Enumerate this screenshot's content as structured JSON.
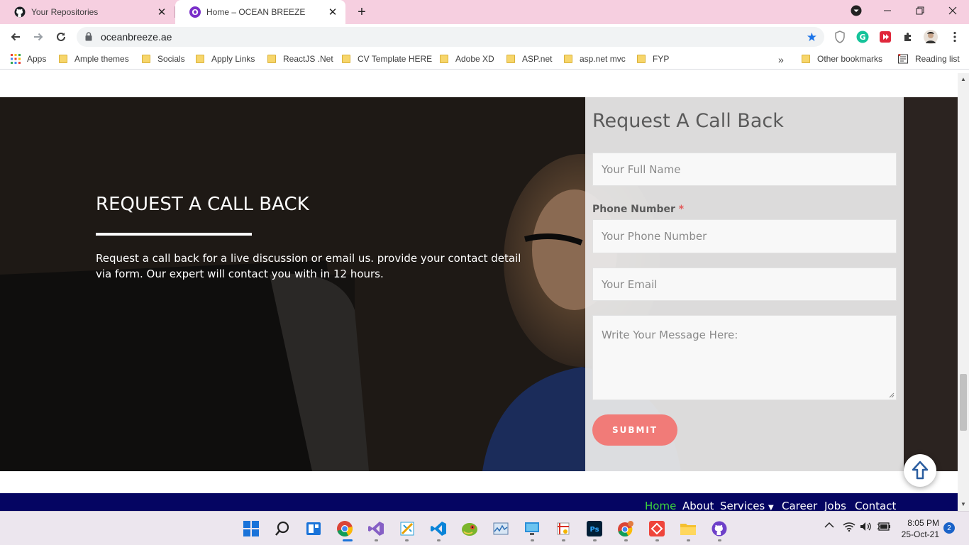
{
  "browser": {
    "tabs": [
      {
        "title": "Your Repositories",
        "favicon": "github-icon",
        "active": false
      },
      {
        "title": "Home – OCEAN BREEZE",
        "favicon": "oceanbreeze-icon",
        "active": true
      }
    ],
    "address": "oceanbreeze.ae",
    "bookmarks": [
      {
        "label": "Apps"
      },
      {
        "label": "Ample themes"
      },
      {
        "label": "Socials"
      },
      {
        "label": "Apply Links"
      },
      {
        "label": "ReactJS .Net"
      },
      {
        "label": "CV Template HERE"
      },
      {
        "label": "Adobe XD"
      },
      {
        "label": "ASP.net"
      },
      {
        "label": "asp.net mvc"
      },
      {
        "label": "FYP"
      },
      {
        "label": "Other bookmarks"
      },
      {
        "label": "Reading list"
      }
    ],
    "overflow_chevron": "»",
    "colors": {
      "tabstrip": "#f6cfe0",
      "star": "#1a73e8"
    }
  },
  "hero": {
    "heading": "REQUEST A CALL BACK",
    "description": "Request a call back for a live discussion or email us. provide your contact detail via form. Our expert will contact you with in 12 hours."
  },
  "form": {
    "title": "Request A Call Back",
    "name_placeholder": "Your Full Name",
    "phone_label": "Phone Number",
    "required_mark": "*",
    "phone_placeholder": "Your Phone Number",
    "email_placeholder": "Your Email",
    "message_placeholder": "Write Your Message Here:",
    "submit_label": "SUBMIT",
    "colors": {
      "submit": "#f17b78",
      "required": "#e25c5c"
    }
  },
  "footer": {
    "nav": [
      {
        "label": "Home",
        "active": true
      },
      {
        "label": "About",
        "active": false
      },
      {
        "label": "Services",
        "active": false,
        "dropdown": true
      },
      {
        "label": "Career",
        "active": false
      },
      {
        "label": "Jobs",
        "active": false
      },
      {
        "label": "Contact",
        "active": false
      }
    ],
    "colors": {
      "background": "#050562",
      "active": "#3dd33d"
    }
  },
  "taskbar": {
    "time": "8:05 PM",
    "date": "25-Oct-21",
    "notification_count": "2"
  }
}
